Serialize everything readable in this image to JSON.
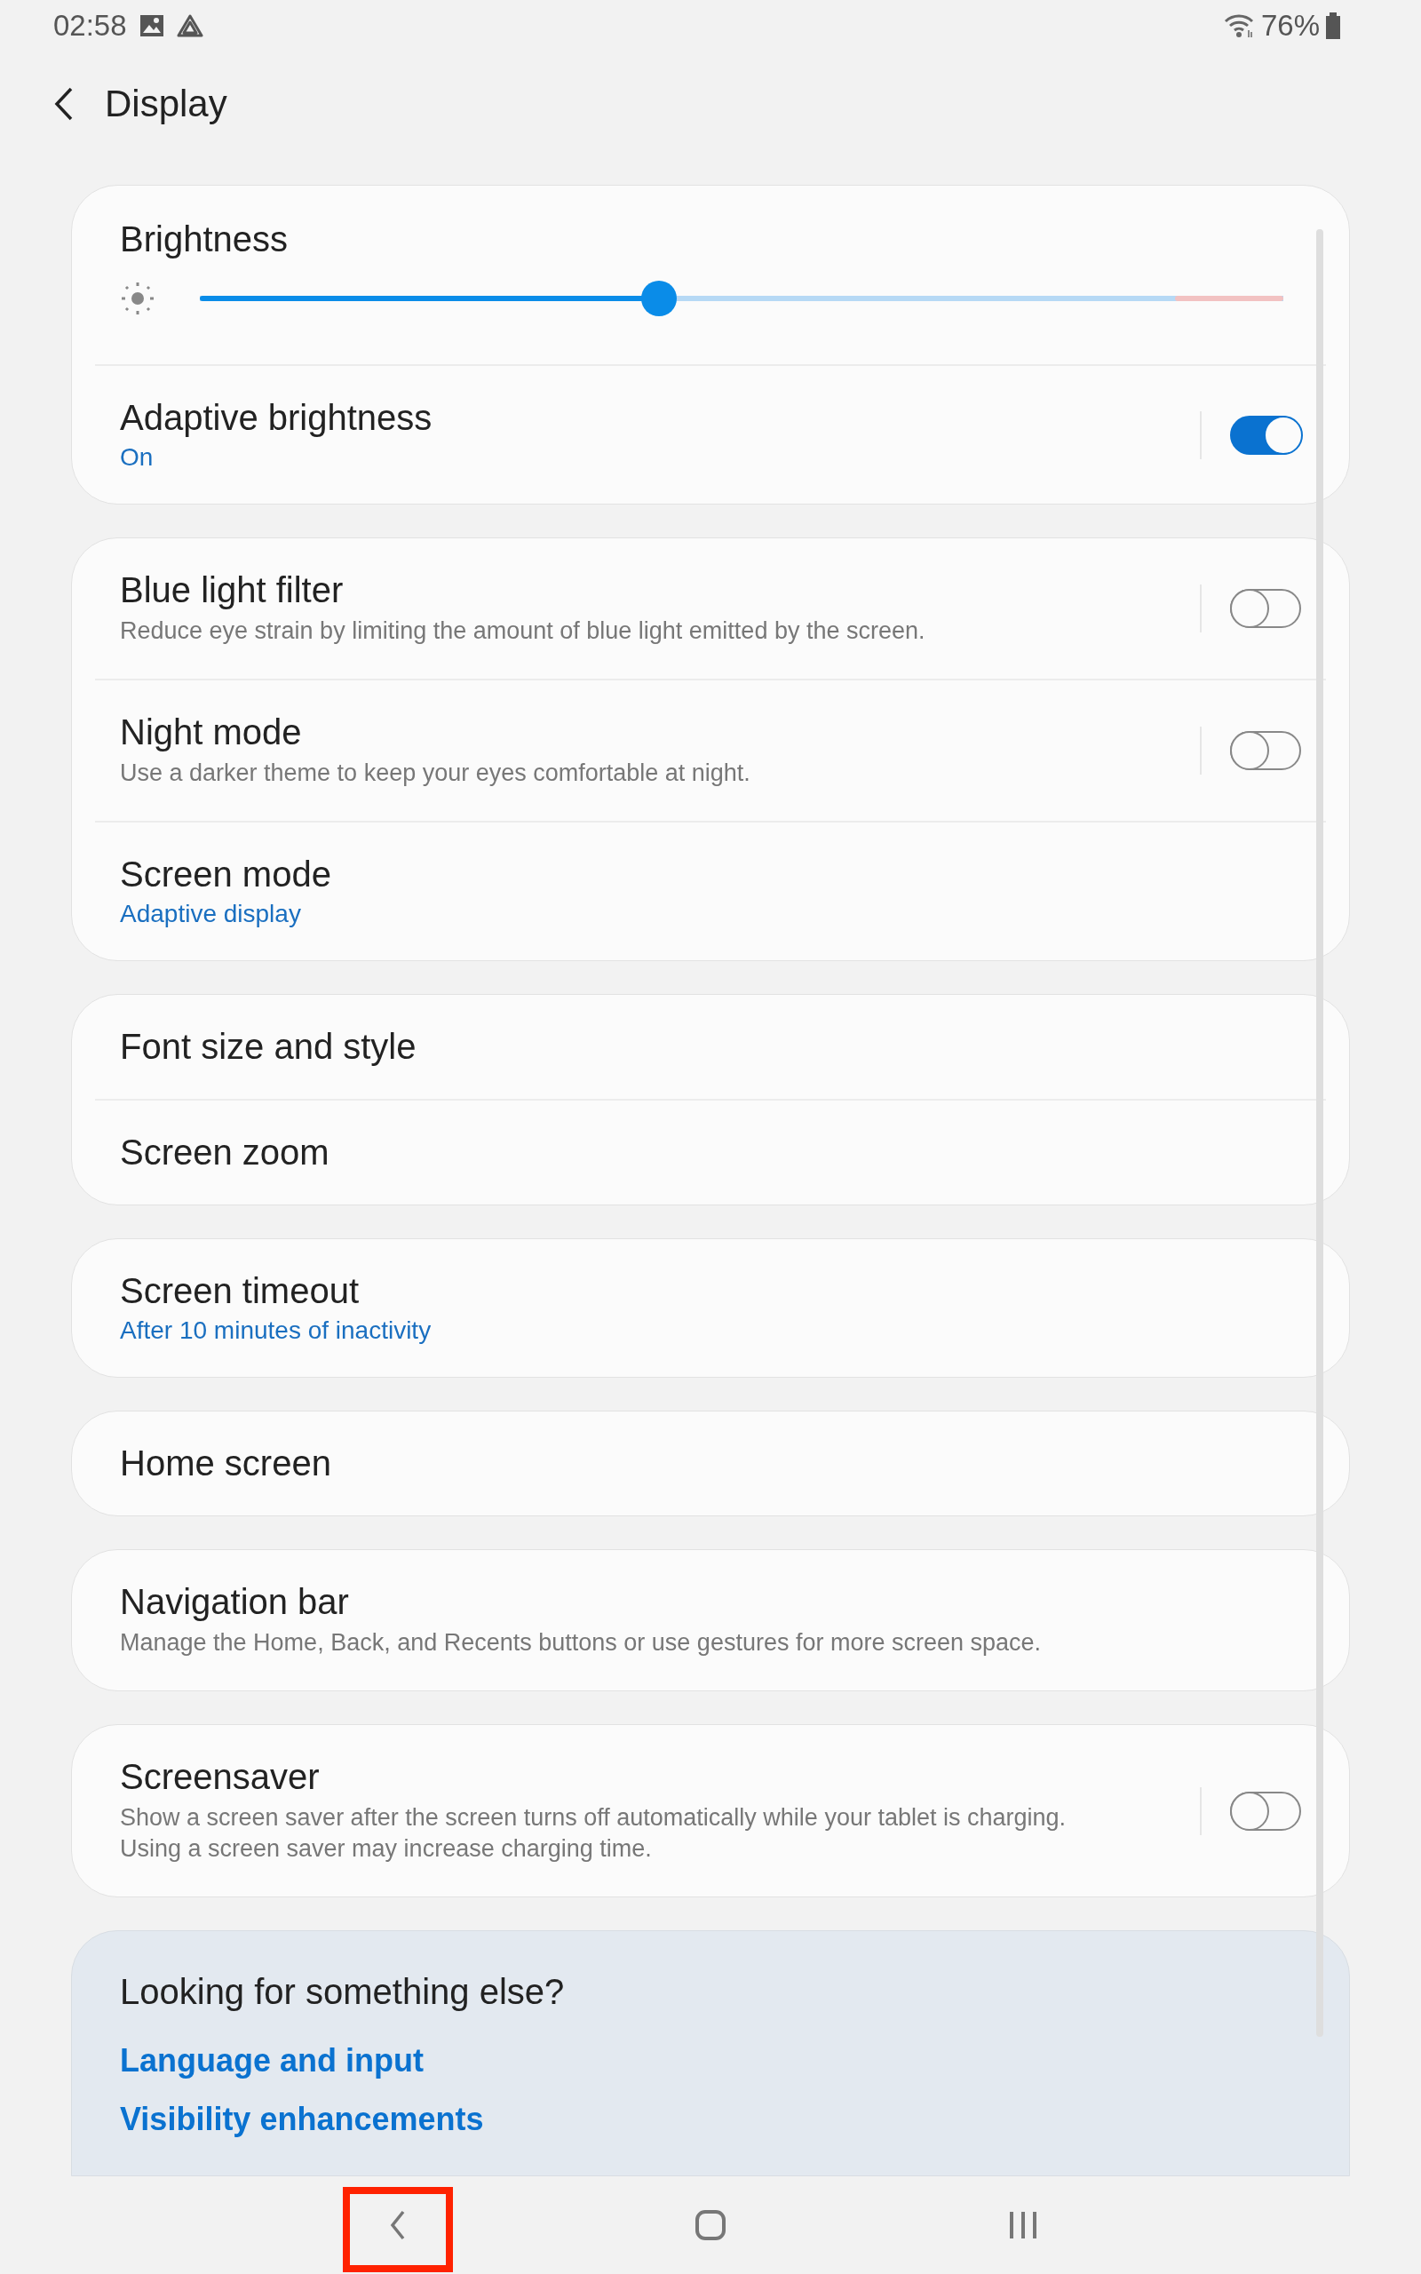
{
  "status_bar": {
    "time": "02:58",
    "battery": "76%"
  },
  "header": {
    "title": "Display"
  },
  "groups": [
    {
      "items": [
        {
          "kind": "slider",
          "title": "Brightness",
          "level": 0.424
        },
        {
          "kind": "switch",
          "title": "Adaptive brightness",
          "value": "On",
          "on": true
        }
      ]
    },
    {
      "items": [
        {
          "kind": "switch",
          "title": "Blue light filter",
          "summary": "Reduce eye strain by limiting the amount of blue light emitted by the screen.",
          "on": false
        },
        {
          "kind": "switch",
          "title": "Night mode",
          "summary": "Use a darker theme to keep your eyes comfortable at night.",
          "on": false
        },
        {
          "kind": "link",
          "title": "Screen mode",
          "value": "Adaptive display"
        }
      ]
    },
    {
      "items": [
        {
          "kind": "link",
          "title": "Font size and style"
        },
        {
          "kind": "link",
          "title": "Screen zoom"
        }
      ]
    },
    {
      "items": [
        {
          "kind": "link",
          "title": "Screen timeout",
          "value": "After 10 minutes of inactivity"
        }
      ]
    },
    {
      "items": [
        {
          "kind": "link",
          "title": "Home screen"
        }
      ]
    },
    {
      "items": [
        {
          "kind": "link",
          "title": "Navigation bar",
          "summary": "Manage the Home, Back, and Recents buttons or use gestures for more screen space."
        }
      ]
    },
    {
      "items": [
        {
          "kind": "switch",
          "title": "Screensaver",
          "summary": "Show a screen saver after the screen turns off automatically while your tablet is charging. Using a screen saver may increase charging time.",
          "on": false
        }
      ]
    }
  ],
  "suggestions": {
    "title": "Looking for something else?",
    "links": [
      "Language and input",
      "Visibility enhancements"
    ]
  },
  "nav_bar": {
    "buttons": [
      {
        "kind": "back",
        "highlighted": true
      },
      {
        "kind": "home",
        "highlighted": false
      },
      {
        "kind": "recents",
        "highlighted": false
      }
    ]
  }
}
